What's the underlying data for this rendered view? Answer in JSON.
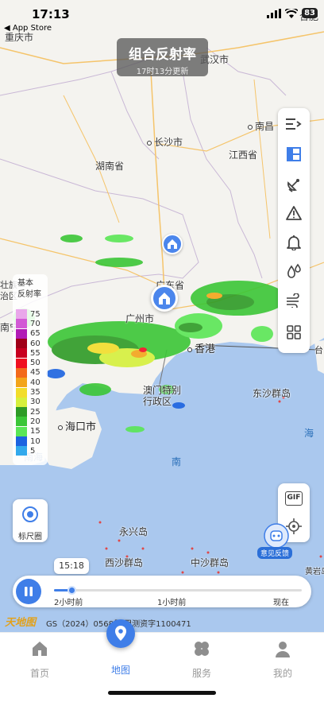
{
  "status_bar": {
    "time": "17:13",
    "back_app": "◀ App Store",
    "battery": "83"
  },
  "title_card": {
    "title": "组合反射率",
    "subtitle": "17时13分更新"
  },
  "map": {
    "places": [
      {
        "name": "重庆市",
        "kind": "city"
      },
      {
        "name": "武汉市",
        "kind": "city"
      },
      {
        "name": "合肥",
        "kind": "city"
      },
      {
        "name": "南昌",
        "kind": "city"
      },
      {
        "name": "长沙市",
        "kind": "city"
      },
      {
        "name": "湖南省",
        "kind": "province"
      },
      {
        "name": "江西省",
        "kind": "province"
      },
      {
        "name": "广东省",
        "kind": "province"
      },
      {
        "name": "广州市",
        "kind": "city"
      },
      {
        "name": "香港",
        "kind": "city"
      },
      {
        "name": "澳门特别行政区",
        "kind": "region"
      },
      {
        "name": "东沙群岛",
        "kind": "island"
      },
      {
        "name": "海口市",
        "kind": "city"
      },
      {
        "name": "永兴岛",
        "kind": "island"
      },
      {
        "name": "西沙群岛",
        "kind": "island"
      },
      {
        "name": "中沙群岛",
        "kind": "island"
      },
      {
        "name": "黄岩岛",
        "kind": "island"
      },
      {
        "name": "南",
        "kind": "sea"
      },
      {
        "name": "海",
        "kind": "sea"
      },
      {
        "name": "南宁",
        "kind": "city"
      },
      {
        "name": "壮族",
        "kind": "region"
      },
      {
        "name": "治区",
        "kind": "region"
      },
      {
        "name": "台",
        "kind": "region"
      },
      {
        "name": "南海",
        "kind": "sea"
      }
    ]
  },
  "legend": {
    "title_line1": "基本",
    "title_line2": "反射率",
    "items": [
      {
        "value": "75",
        "color": "#e9a7ea"
      },
      {
        "value": "70",
        "color": "#d25ad5"
      },
      {
        "value": "65",
        "color": "#b11cb5"
      },
      {
        "value": "60",
        "color": "#a00018"
      },
      {
        "value": "55",
        "color": "#c8001f"
      },
      {
        "value": "50",
        "color": "#f01020"
      },
      {
        "value": "45",
        "color": "#f36a1b"
      },
      {
        "value": "40",
        "color": "#f3a51b"
      },
      {
        "value": "35",
        "color": "#f2dd2a"
      },
      {
        "value": "30",
        "color": "#d6f03c"
      },
      {
        "value": "25",
        "color": "#2e9b26"
      },
      {
        "value": "20",
        "color": "#3bc637"
      },
      {
        "value": "15",
        "color": "#5ae656"
      },
      {
        "value": "10",
        "color": "#1c63e0"
      },
      {
        "value": "5",
        "color": "#32a9ec"
      }
    ]
  },
  "controls": {
    "ruler_label": "标尺圈",
    "gif_label": "GIF",
    "feedback_label": "意见反馈"
  },
  "timeline": {
    "current_time": "15:18",
    "progress": 0.07,
    "labels": [
      "2小时前",
      "1小时前",
      "现在"
    ]
  },
  "credit": {
    "logo": "天地图",
    "text": "GS（2024）0568号  甲测资字1100471"
  },
  "tabs": [
    {
      "label": "首页",
      "icon": "home-icon",
      "active": false
    },
    {
      "label": "地图",
      "icon": "map-pin-icon",
      "active": true
    },
    {
      "label": "服务",
      "icon": "clover-icon",
      "active": false
    },
    {
      "label": "我的",
      "icon": "person-icon",
      "active": false
    }
  ],
  "colors": {
    "accent": "#3f7ee8",
    "land": "#f4f3ef",
    "sea": "#aac8ee"
  }
}
